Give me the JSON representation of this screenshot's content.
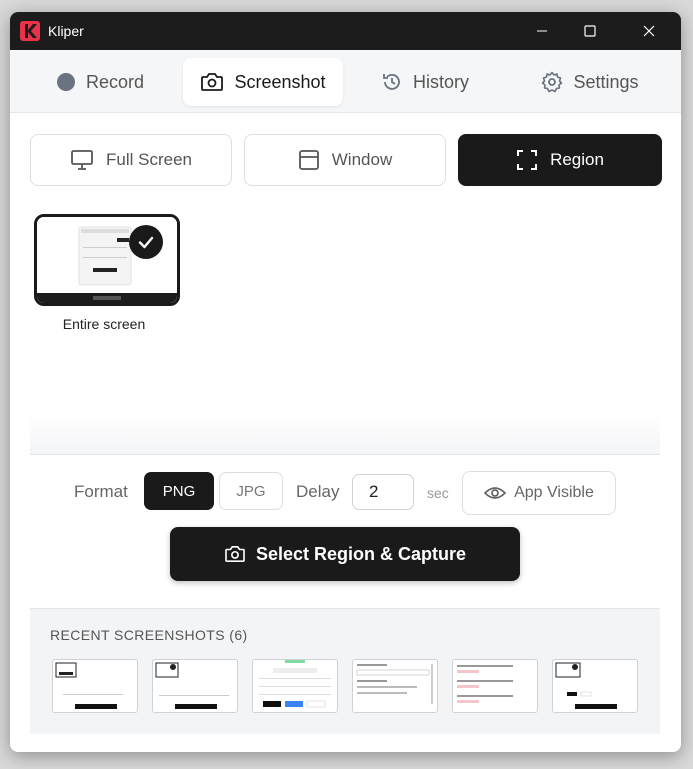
{
  "app": {
    "title": "Kliper",
    "logo_letter": "K",
    "brand_color": "#e8334a"
  },
  "tabs": [
    {
      "label": "Record",
      "icon": "record-dot-icon"
    },
    {
      "label": "Screenshot",
      "icon": "camera-icon",
      "active": true
    },
    {
      "label": "History",
      "icon": "history-icon"
    },
    {
      "label": "Settings",
      "icon": "gear-icon"
    }
  ],
  "modes": [
    {
      "label": "Full Screen",
      "icon": "monitor-icon"
    },
    {
      "label": "Window",
      "icon": "window-icon"
    },
    {
      "label": "Region",
      "icon": "region-icon",
      "active": true
    }
  ],
  "screens": [
    {
      "label": "Entire screen",
      "selected": true
    }
  ],
  "options": {
    "format_label": "Format",
    "formats": [
      "PNG",
      "JPG"
    ],
    "selected_format": "PNG",
    "delay_label": "Delay",
    "delay_value": "2",
    "delay_unit": "sec",
    "visibility_label": "App Visible"
  },
  "capture": {
    "label": "Select Region & Capture"
  },
  "recent": {
    "title": "RECENT SCREENSHOTS (6)"
  }
}
